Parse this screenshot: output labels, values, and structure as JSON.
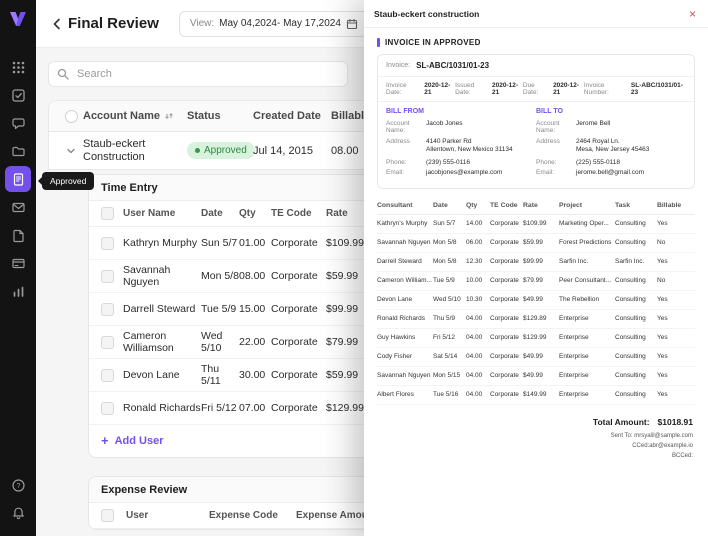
{
  "colors": {
    "accent": "#7450EB",
    "approved_bg": "#D9F2DE",
    "approved_text": "#2B8A3E",
    "close_red": "#E5484D",
    "sidebar_bg": "#131313"
  },
  "sidebar": {
    "tooltip": "Approved"
  },
  "header": {
    "title": "Final Review",
    "view_label": "View:",
    "view_value": "May 04,2024- May 17,2024"
  },
  "search": {
    "placeholder": "Search"
  },
  "accounts": {
    "columns": {
      "name": "Account Name",
      "status": "Status",
      "created": "Created Date",
      "billable": "Billable Hours"
    },
    "row": {
      "name": "Staub-eckert Construction",
      "status": "Approved",
      "created": "Jul 14, 2015",
      "billable": "08.00"
    }
  },
  "time_entry": {
    "title": "Time Entry",
    "columns": {
      "user": "User Name",
      "date": "Date",
      "qty": "Qty",
      "code": "TE Code",
      "rate": "Rate"
    },
    "rows": [
      {
        "user": "Kathryn Murphy",
        "date": "Sun 5/7",
        "qty": "01.00",
        "code": "Corporate",
        "rate": "$109.99"
      },
      {
        "user": "Savannah Nguyen",
        "date": "Mon 5/8",
        "qty": "08.00",
        "code": "Corporate",
        "rate": "$59.99"
      },
      {
        "user": "Darrell Steward",
        "date": "Tue 5/9",
        "qty": "15.00",
        "code": "Corporate",
        "rate": "$99.99"
      },
      {
        "user": "Cameron Williamson",
        "date": "Wed 5/10",
        "qty": "22.00",
        "code": "Corporate",
        "rate": "$79.99"
      },
      {
        "user": "Devon Lane",
        "date": "Thu 5/11",
        "qty": "30.00",
        "code": "Corporate",
        "rate": "$59.99"
      },
      {
        "user": "Ronald Richards",
        "date": "Fri 5/12",
        "qty": "07.00",
        "code": "Corporate",
        "rate": "$129.99"
      }
    ],
    "add_user": "Add User"
  },
  "expense": {
    "title": "Expense Review",
    "columns": {
      "user": "User",
      "code": "Expense Code",
      "amount": "Expense Amount"
    }
  },
  "panel": {
    "title": "Staub-eckert construction",
    "close": "×",
    "section_label": "INVOICE IN APPROVED",
    "invoice_label": "Invoice:",
    "invoice_number": "SL-ABC/1031/01-23",
    "meta": [
      {
        "label": "Invoice Date:",
        "value": "2020-12-21"
      },
      {
        "label": "Issued Date:",
        "value": "2020-12-21"
      },
      {
        "label": "Due Date:",
        "value": "2020-12-21"
      },
      {
        "label": "Invoice Number:",
        "value": "SL-ABC/1031/01-23"
      }
    ],
    "bill_from": {
      "heading": "BILL FROM",
      "account_label": "Account Name:",
      "account": "Jacob Jones",
      "address_label": "Address",
      "address1": "4140 Parker Rd",
      "address2": "Allentown, New Mexico 31134",
      "phone_label": "Phone:",
      "phone": "(239) 555-0116",
      "email_label": "Email:",
      "email": "jacobjones@example.com"
    },
    "bill_to": {
      "heading": "BILL TO",
      "account_label": "Account Name:",
      "account": "Jerome Bell",
      "address_label": "Address",
      "address1": "2464 Royal Ln.",
      "address2": "Mesa, New Jersey 45463",
      "phone_label": "Phone:",
      "phone": "(225) 555-0118",
      "email_label": "Email:",
      "email": "jerome.bell@gmail.com"
    },
    "table": {
      "columns": {
        "consultant": "Consultant",
        "date": "Date",
        "qty": "Qty",
        "code": "TE Code",
        "rate": "Rate",
        "project": "Project",
        "task": "Task",
        "billable": "Billable"
      },
      "rows": [
        {
          "consultant": "Kathryn's Murphy",
          "date": "Sun 5/7",
          "qty": "14.00",
          "code": "Corporate",
          "rate": "$109.99",
          "project": "Marketing Oper...",
          "task": "Consulting",
          "billable": "Yes"
        },
        {
          "consultant": "Savannah Nguyen",
          "date": "Mon 5/8",
          "qty": "06.00",
          "code": "Corporate",
          "rate": "$59.99",
          "project": "Forest Predictions",
          "task": "Consulting",
          "billable": "No"
        },
        {
          "consultant": "Darrell Steward",
          "date": "Mon 5/8",
          "qty": "12.30",
          "code": "Corporate",
          "rate": "$99.99",
          "project": "Sarfin Inc.",
          "task": "Sarfin Inc.",
          "billable": "Yes"
        },
        {
          "consultant": "Cameron William...",
          "date": "Tue 5/9",
          "qty": "10.00",
          "code": "Corporate",
          "rate": "$79.99",
          "project": "Peer Consultant...",
          "task": "Consulting",
          "billable": "No"
        },
        {
          "consultant": "Devon Lane",
          "date": "Wed 5/10",
          "qty": "10.30",
          "code": "Corporate",
          "rate": "$49.99",
          "project": "The Rebellion",
          "task": "Consulting",
          "billable": "Yes"
        },
        {
          "consultant": "Ronald Richards",
          "date": "Thu 5/9",
          "qty": "04.00",
          "code": "Corporate",
          "rate": "$129.89",
          "project": "Enterprise",
          "task": "Consulting",
          "billable": "Yes"
        },
        {
          "consultant": "Guy Hawkins",
          "date": "Fri 5/12",
          "qty": "04.00",
          "code": "Corporate",
          "rate": "$129.99",
          "project": "Enterprise",
          "task": "Consulting",
          "billable": "Yes"
        },
        {
          "consultant": "Cody Fisher",
          "date": "Sat 5/14",
          "qty": "04.00",
          "code": "Corporate",
          "rate": "$49.99",
          "project": "Enterprise",
          "task": "Consulting",
          "billable": "Yes"
        },
        {
          "consultant": "Savannah Nguyen",
          "date": "Mon 5/15",
          "qty": "04.00",
          "code": "Corporate",
          "rate": "$49.99",
          "project": "Enterprise",
          "task": "Consulting",
          "billable": "Yes"
        },
        {
          "consultant": "Albert Flores",
          "date": "Tue 5/16",
          "qty": "04.00",
          "code": "Corporate",
          "rate": "$149.99",
          "project": "Enterprise",
          "task": "Consulting",
          "billable": "Yes"
        }
      ]
    },
    "total_label": "Total Amount:",
    "total_value": "$1018.91",
    "sent_to": "Sent To:  mrsyalil@sample.com",
    "cced": "CCed:abr@example.io",
    "bcced": "BCCed:"
  }
}
